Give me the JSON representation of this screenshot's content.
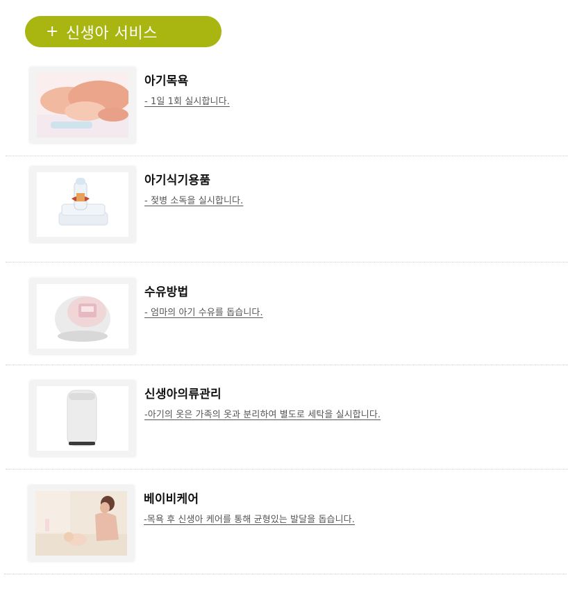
{
  "header": {
    "plus": "+",
    "title": "신생아 서비스"
  },
  "colors": {
    "accent": "#a9b611",
    "divider": "#cfcfcf"
  },
  "items": [
    {
      "title": "아기목욕",
      "desc": "- 1일 1회 실시합니다.",
      "image": "baby-feet-photo"
    },
    {
      "title": "아기식기용품",
      "desc": "- 젖병 소독을 실시합니다.",
      "image": "baby-bottle-photo"
    },
    {
      "title": "수유방법",
      "desc": "- 엄마의 아기 수유를 돕습니다.",
      "image": "breast-pump-photo"
    },
    {
      "title": "신생아의류관리",
      "desc": "-아기의 옷은 가족의 옷과 분리하여 별도로 세탁을 실시합니다.",
      "image": "mini-washer-photo"
    },
    {
      "title": "베이비케어",
      "desc": "-목욕 후 신생아 케어를 통해 균형있는 발달을 돕습니다.",
      "image": "mother-baby-photo"
    }
  ]
}
